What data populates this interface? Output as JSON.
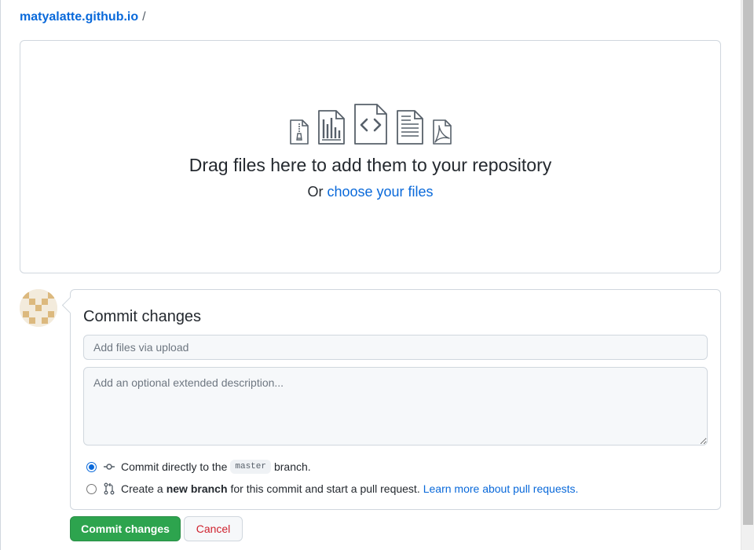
{
  "breadcrumb": {
    "repo": "matyalatte.github.io",
    "separator": "/"
  },
  "dropzone": {
    "title": "Drag files here to add them to your repository",
    "prefix": "Or",
    "choose_link": "choose your files",
    "icons": [
      "file-zip-icon",
      "file-chart-icon",
      "file-code-icon",
      "file-text-icon",
      "file-pdf-icon"
    ]
  },
  "commit": {
    "heading": "Commit changes",
    "summary_placeholder": "Add files via upload",
    "summary_value": "",
    "description_placeholder": "Add an optional extended description...",
    "description_value": "",
    "option_direct": {
      "prefix": "Commit directly to the",
      "branch": "master",
      "suffix": "branch.",
      "selected": true
    },
    "option_new": {
      "prefix": "Create a",
      "bold": "new branch",
      "suffix": "for this commit and start a pull request.",
      "link": "Learn more about pull requests.",
      "selected": false
    }
  },
  "buttons": {
    "commit": "Commit changes",
    "cancel": "Cancel"
  },
  "colors": {
    "link": "#0969da",
    "primary_button": "#2da44e",
    "danger_text": "#cf222e",
    "border": "#d0d7de"
  }
}
